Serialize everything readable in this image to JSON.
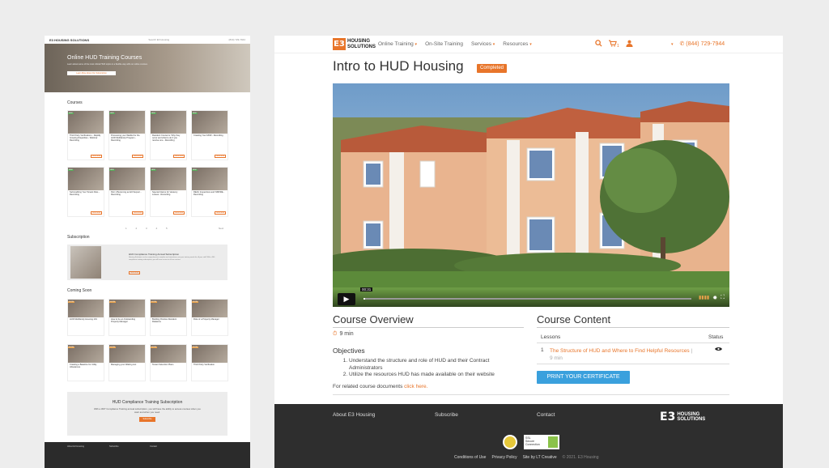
{
  "left_page": {
    "nav_logo": "E3 HOUSING SOLUTIONS",
    "nav_search": "Search E3 Housing",
    "nav_phone": "(844) 729-7944",
    "hero_title": "Online HUD Training Courses",
    "hero_sub": "Learn about some of the most critical HUD topics in a flexible way with our online courses.",
    "hero_button": "Learn More About Our Subscription",
    "courses_heading": "Courses",
    "courses": [
      {
        "tag": "NEW",
        "title": "Third Party Verifications - Rapidly Growing Disparities - Webinar Recording",
        "btn": "Learn More"
      },
      {
        "tag": "NEW",
        "title": "Processing your Waitlist for the HUD Multifamily Program - Recording",
        "btn": "Learn More"
      },
      {
        "tag": "NEW",
        "title": "Resident Concerns: Why they occur and what to do if you receive one - Recording",
        "btn": "Learn More"
      },
      {
        "tag": "NEW",
        "title": "Creating Your MOR - Recording",
        "btn": "Learn More"
      },
      {
        "tag": "NEW",
        "title": "Self-Auditing Your Tenant Files - Recording",
        "btn": "Learn More"
      },
      {
        "tag": "NEW",
        "title": "Part 1 Becoming an EIV Expert - Recording",
        "btn": "Learn More"
      },
      {
        "tag": "NEW",
        "title": "Special Claims for Vacancy Losses - Recording",
        "btn": "Learn More"
      },
      {
        "tag": "NEW",
        "title": "REAC Inspections and NSPIRE - Recording",
        "btn": "Learn More"
      }
    ],
    "pager": "1 2 3 4 5",
    "pager_next": "Next",
    "subscription_heading": "Subscription",
    "sub_title": "HUD Compliance Training Annual Subscription",
    "sub_desc": "Housing Solutions can be comprehensive complete and sometimes, just your training needs for all your staff. With a 360 compliance training subscription, you will have access to all our courses.",
    "sub_btn": "Learn More",
    "coming_soon_heading": "Coming Soon",
    "coming": [
      {
        "tag": "SOON",
        "title": "HUD Multifamily Housing 101"
      },
      {
        "tag": "SOON",
        "title": "How to be an Outstanding Property Manager"
      },
      {
        "tag": "SOON",
        "title": "Building Positive Resident Relations"
      },
      {
        "tag": "SOON",
        "title": "Role of a Property Manager"
      },
      {
        "tag": "SOON",
        "title": "Creating a Baseline for Utility Allowances"
      },
      {
        "tag": "SOON",
        "title": "Managing your Waiting List"
      },
      {
        "tag": "SOON",
        "title": "Tenant Selection Plans"
      },
      {
        "tag": "SOON",
        "title": "Third Party Verification"
      }
    ],
    "cta_title": "HUD Compliance Training Subscription",
    "cta_text": "With a 360° Compliance Training annual subscription, you will have the ability to access courses when you want and when you need.",
    "cta_btn": "Subscribe",
    "footer": {
      "about": "About E3 Housing",
      "subscribe": "Subscribe",
      "contact": "Contact"
    }
  },
  "header": {
    "logo_mark": "E3",
    "logo_text_1": "HOUSING",
    "logo_text_2": "SOLUTIONS",
    "menu": [
      {
        "label": "Online Training",
        "caret": "▾"
      },
      {
        "label": "On-Site Training",
        "caret": ""
      },
      {
        "label": "Services",
        "caret": "▾"
      },
      {
        "label": "Resources",
        "caret": "▾"
      }
    ],
    "cart_count": "1",
    "phone": "(844) 729-7944"
  },
  "page": {
    "title": "Intro to HUD Housing",
    "status_badge": "Completed"
  },
  "video": {
    "time": "00:31",
    "progress": 0.005
  },
  "overview": {
    "title": "Course Overview",
    "duration": "9 min",
    "objectives_heading": "Objectives",
    "objectives": [
      "Understand the structure and role of HUD and their Contract Administrators",
      "Utilize the resources HUD has made available on their website"
    ],
    "related_prefix": "For related course documents",
    "related_link": "click here."
  },
  "content": {
    "title": "Course Content",
    "col_lessons": "Lessons",
    "col_status": "Status",
    "lessons": [
      {
        "num": "1",
        "title": "The Structure of HUD and Where to Find Helpful Resources",
        "duration": "9 min"
      }
    ],
    "cert_button": "PRINT YOUR CERTIFICATE"
  },
  "footer": {
    "about": "About E3 Housing",
    "subscribe": "Subscribe",
    "contact": "Contact",
    "ssl_1": "SSL",
    "ssl_2": "Secure",
    "ssl_3": "Connection",
    "links": [
      "Conditions of Use",
      "Privacy Policy",
      "Site by LT Creative"
    ],
    "copyright": "© 2021. E3 Housing"
  },
  "colors": {
    "accent": "#e8752a",
    "button_blue": "#3aa0dd",
    "footer_bg": "#2e2e2e"
  }
}
